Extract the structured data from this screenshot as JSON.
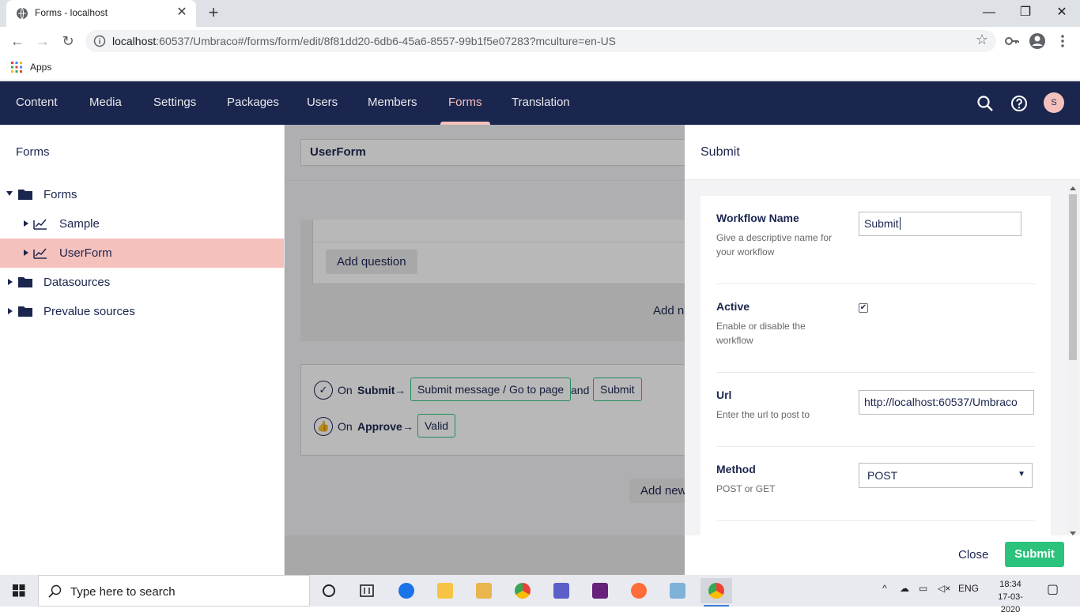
{
  "browser": {
    "tab_title": "Forms - localhost",
    "tab_close": "✕",
    "new_tab": "+",
    "url_host": "localhost",
    "url_path": ":60537/Umbraco#/forms/form/edit/8f81dd20-6db6-45a6-8557-99b1f5e07283?mculture=en-US",
    "bookmarks": [
      {
        "label": "Apps"
      }
    ],
    "window_controls": {
      "minimize": "—",
      "restore": "❐",
      "close": "✕"
    }
  },
  "header": {
    "sections": [
      "Content",
      "Media",
      "Settings",
      "Packages",
      "Users",
      "Members",
      "Forms",
      "Translation"
    ],
    "active_section": "Forms",
    "avatar_initial": "S"
  },
  "tree": {
    "title": "Forms",
    "items": [
      {
        "label": "Forms",
        "expanded": true,
        "icon": "folder-icon"
      },
      {
        "label": "Sample",
        "icon": "form-icon"
      },
      {
        "label": "UserForm",
        "icon": "form-icon",
        "selected": true
      },
      {
        "label": "Datasources",
        "icon": "folder-icon"
      },
      {
        "label": "Prevalue sources",
        "icon": "folder-icon"
      }
    ]
  },
  "editor": {
    "form_name": "UserForm",
    "add_question": "Add question",
    "add_new_1": "Add new",
    "add_new_2": "Add new",
    "workflows": {
      "on": "On",
      "submit_event": "Submit",
      "approve_event": "Approve",
      "arrow": "→",
      "and": "and",
      "submit_pills": [
        "Submit message / Go to page",
        "Submit"
      ],
      "approve_pills": [
        "Valid"
      ]
    }
  },
  "panel": {
    "title": "Submit",
    "fields": [
      {
        "label": "Workflow Name",
        "description": "Give a descriptive name for your workflow",
        "value": "Submit"
      },
      {
        "label": "Active",
        "description": "Enable or disable the workflow",
        "checked": true
      },
      {
        "label": "Url",
        "description": "Enter the url to post to",
        "value": "http://localhost:60537/Umbraco"
      },
      {
        "label": "Method",
        "description": "POST or GET",
        "value": "POST"
      }
    ],
    "close_label": "Close",
    "submit_label": "Submit"
  },
  "taskbar": {
    "search_placeholder": "Type here to search",
    "language": "ENG",
    "time": "18:34",
    "date": "17-03-2020"
  },
  "colors": {
    "header_bg": "#1b264f",
    "accent_pink": "#f5c1bc",
    "success_green": "#2bc37c"
  }
}
